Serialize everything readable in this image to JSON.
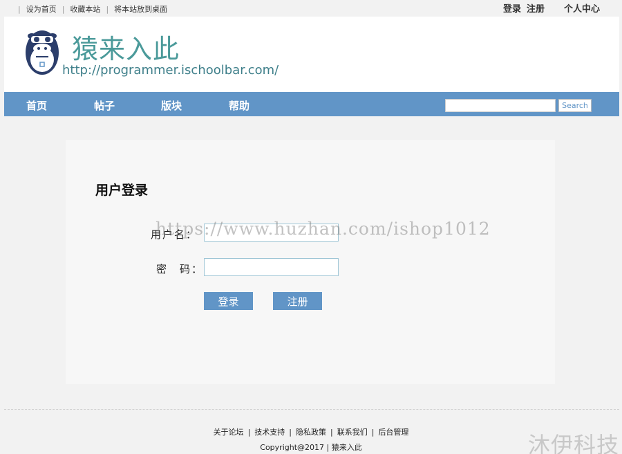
{
  "topbar": {
    "links": [
      "设为首页",
      "收藏本站",
      "将本站放到桌面"
    ],
    "login": "登录",
    "register": "注册",
    "user_center": "个人中心"
  },
  "header": {
    "title": "猿来入此",
    "url": "http://programmer.ischoolbar.com/"
  },
  "nav": {
    "items": [
      "首页",
      "帖子",
      "版块",
      "帮助"
    ],
    "search_value": "",
    "search_button": "Search"
  },
  "login": {
    "title": "用户登录",
    "username_label": "用户名：",
    "username_value": "",
    "password_label": "密　码：",
    "password_value": "",
    "login_button": "登录",
    "register_button": "注册"
  },
  "watermark": "https://www.huzhan.com/ishop1012",
  "footer": {
    "links": [
      "关于论坛",
      "技术支持",
      "隐私政策",
      "联系我们",
      "后台管理"
    ],
    "copyright": "Copyright@2017 | 猿来入此"
  },
  "brand_watermark": "沐伊科技",
  "colors": {
    "nav": "#6195c7",
    "title": "#4b9a9a",
    "input_border": "#9fc6d6"
  }
}
